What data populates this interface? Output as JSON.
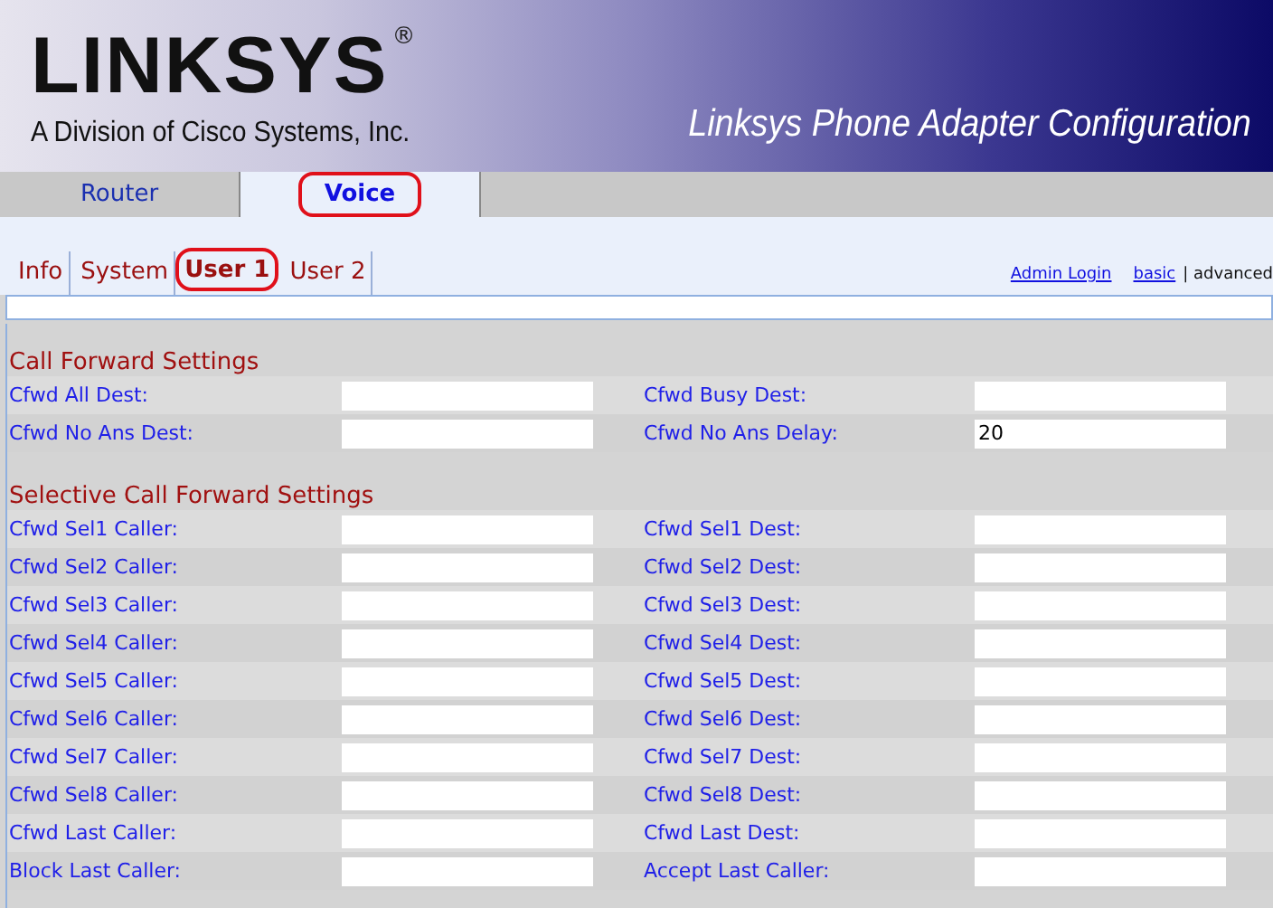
{
  "header": {
    "logo": "LINKSYS",
    "registered": "®",
    "tagline": "A Division of Cisco Systems, Inc.",
    "title": "Linksys Phone Adapter Configuration"
  },
  "tabs": [
    {
      "label": "Router",
      "selected": false
    },
    {
      "label": "Voice",
      "selected": true
    }
  ],
  "subtabs": [
    {
      "label": "Info",
      "selected": false
    },
    {
      "label": "System",
      "selected": false
    },
    {
      "label": "User 1",
      "selected": true
    },
    {
      "label": "User 2",
      "selected": false
    }
  ],
  "links": [
    {
      "label": "Admin Login"
    },
    {
      "label": "basic"
    }
  ],
  "mode_text": "| advanced",
  "sections": [
    {
      "title": "Call Forward Settings",
      "rows": [
        {
          "left": {
            "label": "Cfwd All Dest:"
          },
          "right": {
            "label": "Cfwd Busy Dest:"
          }
        },
        {
          "left": {
            "label": "Cfwd No Ans Dest:"
          },
          "right": {
            "label": "Cfwd No Ans Delay:",
            "value": "20"
          }
        }
      ]
    },
    {
      "title": "Selective Call Forward Settings",
      "rows": [
        {
          "left": {
            "label": "Cfwd Sel1 Caller:"
          },
          "right": {
            "label": "Cfwd Sel1 Dest:"
          }
        },
        {
          "left": {
            "label": "Cfwd Sel2 Caller:"
          },
          "right": {
            "label": "Cfwd Sel2 Dest:"
          }
        },
        {
          "left": {
            "label": "Cfwd Sel3 Caller:"
          },
          "right": {
            "label": "Cfwd Sel3 Dest:"
          }
        },
        {
          "left": {
            "label": "Cfwd Sel4 Caller:"
          },
          "right": {
            "label": "Cfwd Sel4 Dest:"
          }
        },
        {
          "left": {
            "label": "Cfwd Sel5 Caller:"
          },
          "right": {
            "label": "Cfwd Sel5 Dest:"
          }
        },
        {
          "left": {
            "label": "Cfwd Sel6 Caller:"
          },
          "right": {
            "label": "Cfwd Sel6 Dest:"
          }
        },
        {
          "left": {
            "label": "Cfwd Sel7 Caller:"
          },
          "right": {
            "label": "Cfwd Sel7 Dest:"
          }
        },
        {
          "left": {
            "label": "Cfwd Sel8 Caller:"
          },
          "right": {
            "label": "Cfwd Sel8 Dest:"
          }
        },
        {
          "left": {
            "label": "Cfwd Last Caller:"
          },
          "right": {
            "label": "Cfwd Last Dest:"
          }
        },
        {
          "left": {
            "label": "Block Last Caller:"
          },
          "right": {
            "label": "Accept Last Caller:"
          }
        }
      ]
    }
  ]
}
